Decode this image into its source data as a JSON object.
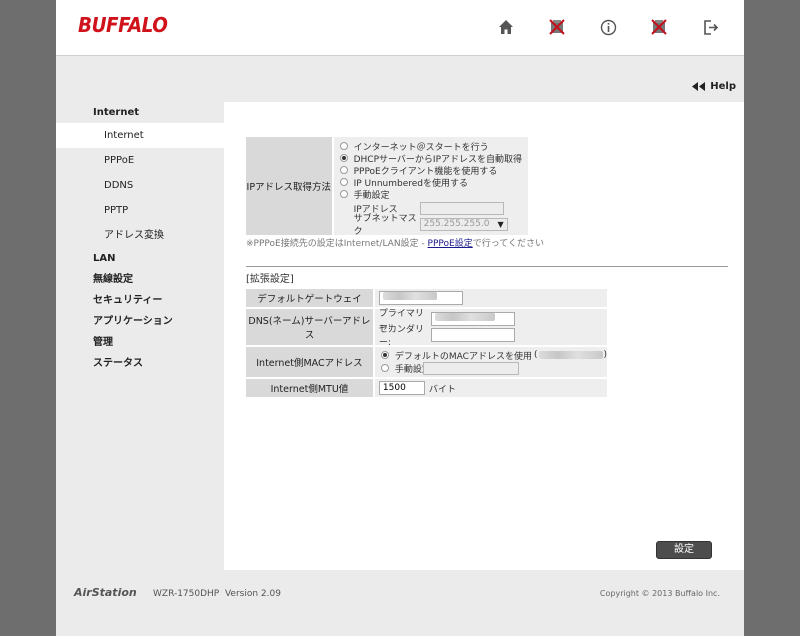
{
  "brand": {
    "logo": "BUFFALO"
  },
  "header_icons": [
    "home-icon",
    "setup-disabled-icon",
    "info-icon",
    "setup-disabled-icon-2",
    "logout-icon"
  ],
  "help": {
    "label": "Help"
  },
  "sidebar": {
    "internet_header": "Internet",
    "items": [
      {
        "label": "Internet",
        "active": true
      },
      {
        "label": "PPPoE"
      },
      {
        "label": "DDNS"
      },
      {
        "label": "PPTP"
      },
      {
        "label": "アドレス変換"
      }
    ],
    "sections": [
      "LAN",
      "無線設定",
      "セキュリティー",
      "アプリケーション",
      "管理",
      "ステータス"
    ]
  },
  "ip_method": {
    "label": "IPアドレス取得方法",
    "options": [
      {
        "label": "インターネット＠スタートを行う",
        "checked": false
      },
      {
        "label": "DHCPサーバーからIPアドレスを自動取得",
        "checked": true
      },
      {
        "label": "PPPoEクライアント機能を使用する",
        "checked": false
      },
      {
        "label": "IP Unnumberedを使用する",
        "checked": false
      },
      {
        "label": "手動設定",
        "checked": false
      }
    ],
    "ip_label": "IPアドレス",
    "ip_value": "",
    "subnet_label": "サブネットマスク",
    "subnet_value": "255.255.255.0"
  },
  "note": {
    "prefix": "※PPPoE接続先の設定はInternet/LAN設定 - ",
    "link": "PPPoE設定",
    "suffix": "で行ってください"
  },
  "advanced": {
    "title": "[拡張設定]",
    "gateway_label": "デフォルトゲートウェイ",
    "dns_label": "DNS(ネーム)サーバーアドレス",
    "primary_label": "プライマリー:",
    "secondary_label": "セカンダリー:",
    "mac_label": "Internet側MACアドレス",
    "mac_default_label": "デフォルトのMACアドレスを使用",
    "mac_manual_label": "手動設定",
    "mtu_label": "Internet側MTU値",
    "mtu_value": "1500",
    "mtu_unit": "バイト"
  },
  "submit": {
    "label": "設定"
  },
  "footer": {
    "brand": "AirStation",
    "model": "WZR-1750DHP",
    "version": "Version 2.09",
    "copyright": "Copyright © 2013 Buffalo Inc."
  },
  "colors": {
    "brand_red": "#d0121b",
    "frame_bg": "#ebebeb",
    "outer_bg": "#6e6e6e",
    "label_cell": "#d9d9d9"
  }
}
